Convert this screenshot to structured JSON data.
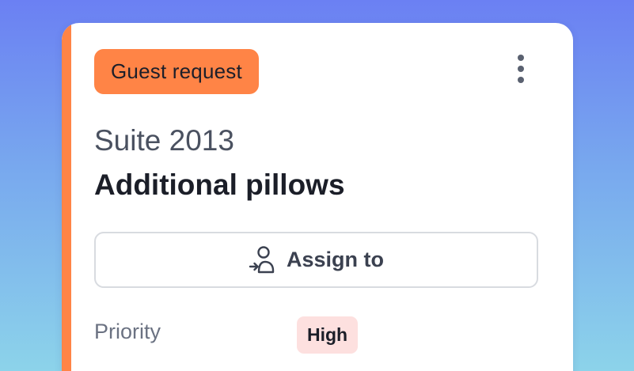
{
  "card": {
    "tag_label": "Guest request",
    "room": "Suite 2013",
    "title": "Additional pillows",
    "assign_label": "Assign to",
    "priority_label": "Priority",
    "priority_value": "High",
    "menu_icon": "more-vertical-icon",
    "assign_icon": "assign-user-icon"
  },
  "colors": {
    "accent": "#ff8446",
    "priority_high_bg": "#fde0df",
    "background_top": "#6b80f3",
    "background_bottom": "#8cd3ea"
  }
}
